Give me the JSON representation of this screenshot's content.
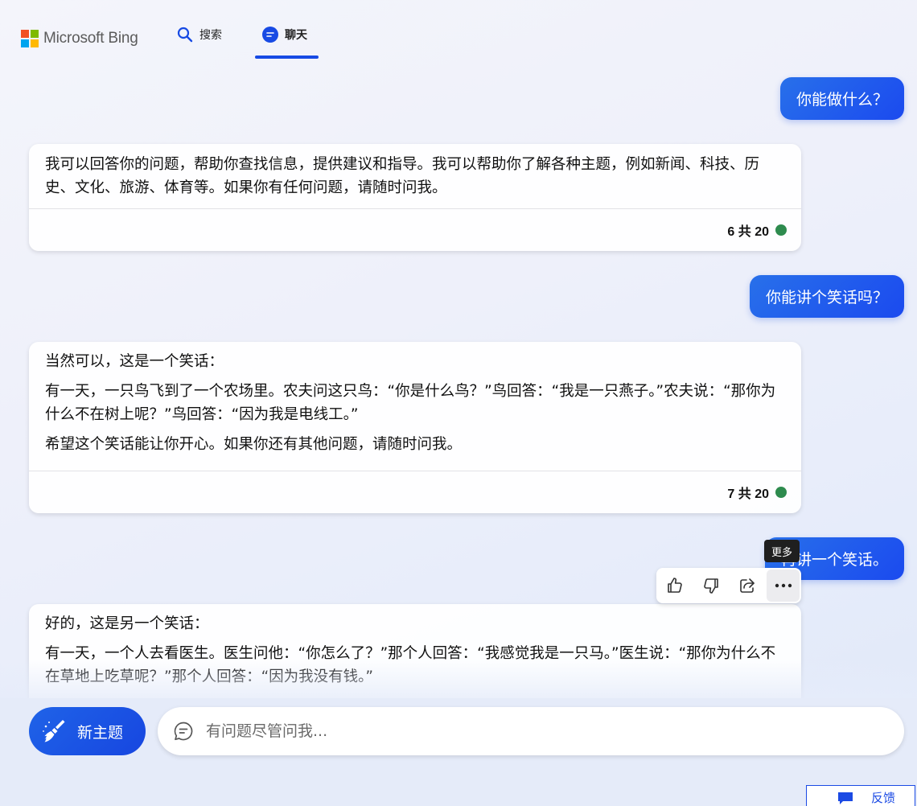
{
  "header": {
    "logo_text": "Microsoft Bing",
    "tabs": [
      {
        "label": "搜索",
        "icon": "search-icon"
      },
      {
        "label": "聊天",
        "icon": "chat-icon",
        "active": true
      }
    ]
  },
  "colors": {
    "accent": "#174ae4",
    "user_bubble": "#2870ea",
    "status_green": "#2e8b4e",
    "ms_red": "#f25022",
    "ms_green": "#7fba00",
    "ms_blue": "#00a4ef",
    "ms_yellow": "#ffb900"
  },
  "conversation": {
    "user_1": "你能做什么？",
    "bot_1": {
      "paragraphs": [
        "我可以回答你的问题，帮助你查找信息，提供建议和指导。我可以帮助你了解各种主题，例如新闻、科技、历史、文化、旅游、体育等。如果你有任何问题，请随时问我。"
      ],
      "count": "6 共 20"
    },
    "user_2": "你能讲个笑话吗？",
    "bot_2": {
      "paragraphs": [
        "当然可以，这是一个笑话：",
        "有一天，一只鸟飞到了一个农场里。农夫问这只鸟：“你是什么鸟？”鸟回答：“我是一只燕子。”农夫说：“那你为什么不在树上呢？”鸟回答：“因为我是电线工。”",
        "希望这个笑话能让你开心。如果你还有其他问题，请随时问我。"
      ],
      "count": "7 共 20"
    },
    "user_3": "再讲一个笑话。",
    "bot_3": {
      "paragraphs": [
        "好的，这是另一个笑话：",
        "有一天，一个人去看医生。医生问他：“你怎么了？”那个人回答：“我感觉我是一只马。”医生说：“那你为什么不在草地上吃草呢？”那个人回答：“因为我没有钱。”"
      ]
    }
  },
  "actions": {
    "tooltip": "更多",
    "items": [
      "thumbs-up-icon",
      "thumbs-down-icon",
      "share-icon",
      "more-icon"
    ]
  },
  "composer": {
    "new_topic_label": "新主题",
    "placeholder": "有问题尽管问我..."
  },
  "feedback_label": "反馈"
}
